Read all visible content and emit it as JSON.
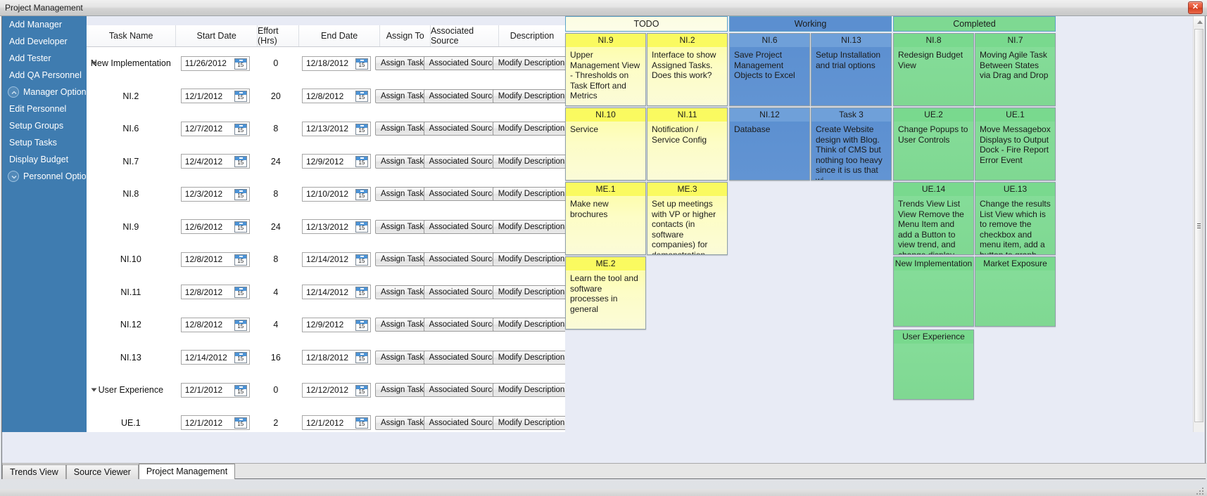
{
  "window": {
    "title": "Project Management",
    "close_label": "×"
  },
  "sidebar": {
    "items": [
      {
        "label": "Add Manager",
        "icon": null
      },
      {
        "label": "Add Developer",
        "icon": null
      },
      {
        "label": "Add Tester",
        "icon": null
      },
      {
        "label": "Add QA Personnel",
        "icon": null
      },
      {
        "label": "Manager Options",
        "icon": "chevron-up-circle-icon"
      },
      {
        "label": "Edit Personnel",
        "icon": null
      },
      {
        "label": "Setup Groups",
        "icon": null
      },
      {
        "label": "Setup Tasks",
        "icon": null
      },
      {
        "label": "Display Budget",
        "icon": null
      },
      {
        "label": "Personnel Options",
        "icon": "chevron-down-circle-icon"
      }
    ]
  },
  "grid": {
    "columns": [
      "Task Name",
      "Start Date",
      "Effort (Hrs)",
      "End Date",
      "Assign To",
      "Associated Source",
      "Description"
    ],
    "assign_button_label": "Assign Task",
    "source_button_label": "Associated Source",
    "description_button_label": "Modify Description",
    "calendar_icon_day": "15",
    "rows": [
      {
        "name": "New Implementation",
        "expandable": true,
        "start": "11/26/2012",
        "effort": "0",
        "end": "12/18/2012"
      },
      {
        "name": "NI.2",
        "expandable": false,
        "start": "12/1/2012",
        "effort": "20",
        "end": "12/8/2012"
      },
      {
        "name": "NI.6",
        "expandable": false,
        "start": "12/7/2012",
        "effort": "8",
        "end": "12/13/2012"
      },
      {
        "name": "NI.7",
        "expandable": false,
        "start": "12/4/2012",
        "effort": "24",
        "end": "12/9/2012"
      },
      {
        "name": "NI.8",
        "expandable": false,
        "start": "12/3/2012",
        "effort": "8",
        "end": "12/10/2012"
      },
      {
        "name": "NI.9",
        "expandable": false,
        "start": "12/6/2012",
        "effort": "24",
        "end": "12/13/2012"
      },
      {
        "name": "NI.10",
        "expandable": false,
        "start": "12/8/2012",
        "effort": "8",
        "end": "12/14/2012"
      },
      {
        "name": "NI.11",
        "expandable": false,
        "start": "12/8/2012",
        "effort": "4",
        "end": "12/14/2012"
      },
      {
        "name": "NI.12",
        "expandable": false,
        "start": "12/8/2012",
        "effort": "4",
        "end": "12/9/2012"
      },
      {
        "name": "NI.13",
        "expandable": false,
        "start": "12/14/2012",
        "effort": "16",
        "end": "12/18/2012"
      },
      {
        "name": "User Experience",
        "expandable": true,
        "start": "12/1/2012",
        "effort": "0",
        "end": "12/12/2012"
      },
      {
        "name": "UE.1",
        "expandable": false,
        "start": "12/1/2012",
        "effort": "2",
        "end": "12/1/2012"
      }
    ]
  },
  "board": {
    "columns": [
      {
        "title": "TODO",
        "accent": "#fafa60",
        "cards": [
          {
            "id": "NI.9",
            "text": "Upper Management View - Thresholds on Task Effort and Metrics"
          },
          {
            "id": "NI.2",
            "text": "Interface to show Assigned Tasks. Does this work?"
          },
          {
            "id": "NI.10",
            "text": "Service"
          },
          {
            "id": "NI.11",
            "text": "Notification / Service Config"
          },
          {
            "id": "ME.1",
            "text": "Make new brochures"
          },
          {
            "id": "ME.3",
            "text": "Set up meetings with VP or higher contacts (in software companies) for demonstration and..."
          },
          {
            "id": "ME.2",
            "text": "Learn the tool and software processes in general"
          }
        ]
      },
      {
        "title": "Working",
        "accent": "#5b8fd0",
        "cards": [
          {
            "id": "NI.6",
            "text": "Save Project Management Objects to Excel"
          },
          {
            "id": "NI.13",
            "text": "Setup Installation and trial options"
          },
          {
            "id": "NI.12",
            "text": "Database"
          },
          {
            "id": "Task 3",
            "text": "Create Website design with Blog. Think of CMS but nothing too heavy since it is us that wi..."
          }
        ]
      },
      {
        "title": "Completed",
        "accent": "#7ed992",
        "cards": [
          {
            "id": "NI.8",
            "text": "Redesign Budget View"
          },
          {
            "id": "NI.7",
            "text": "Moving Agile Task Between States via Drag and Drop"
          },
          {
            "id": "UE.2",
            "text": "Change Popups to User Controls"
          },
          {
            "id": "UE.1",
            "text": "Move Messagebox Displays to Output Dock - Fire Report Error Event"
          },
          {
            "id": "UE.14",
            "text": "Trends View List View Remove the Menu Item and add a Button to view trend, and change display..."
          },
          {
            "id": "UE.13",
            "text": "Change the results List View which is to remove the checkbox and menu item, add a button to graph"
          },
          {
            "id": "New Implementation",
            "text": ""
          },
          {
            "id": "Market Exposure",
            "text": ""
          },
          {
            "id": "User Experience",
            "text": ""
          }
        ]
      }
    ]
  },
  "tabs": [
    {
      "label": "Trends View",
      "active": false
    },
    {
      "label": "Source Viewer",
      "active": false
    },
    {
      "label": "Project Management",
      "active": true
    }
  ]
}
